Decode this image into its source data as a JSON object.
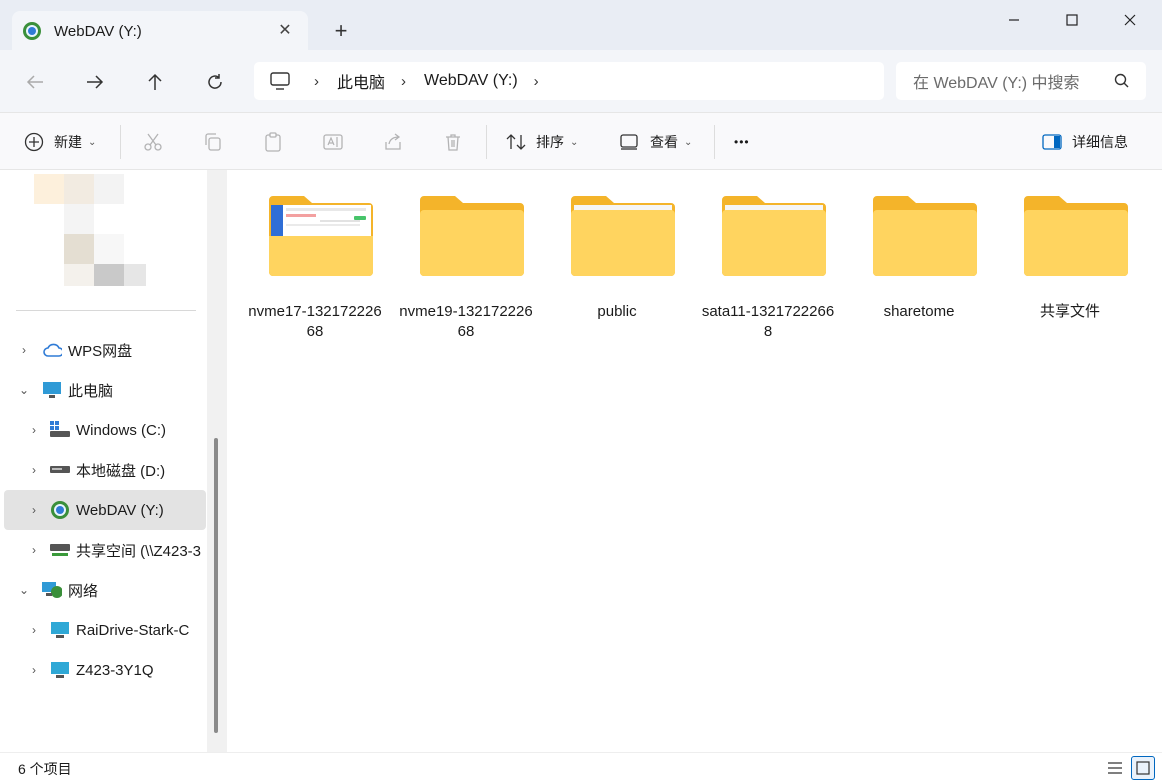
{
  "tab": {
    "title": "WebDAV (Y:)",
    "close": "✕",
    "new_tab": "+"
  },
  "window": {
    "minimize": "—",
    "maximize": "☐",
    "close": "✕"
  },
  "address": {
    "crumbs": [
      "此电脑",
      "WebDAV (Y:)"
    ],
    "search_placeholder": "在 WebDAV (Y:) 中搜索"
  },
  "toolbar": {
    "new_label": "新建",
    "sort_label": "排序",
    "view_label": "查看",
    "more_label": "•••",
    "details_label": "详细信息"
  },
  "sidebar": {
    "items": [
      {
        "label": "WPS网盘",
        "chevron": "›",
        "icon": "cloud-icon"
      },
      {
        "label": "此电脑",
        "chevron": "⌄",
        "icon": "monitor-icon"
      },
      {
        "label": "Windows (C:)",
        "chevron": "›",
        "icon": "windows-drive-icon"
      },
      {
        "label": "本地磁盘 (D:)",
        "chevron": "›",
        "icon": "drive-icon"
      },
      {
        "label": "WebDAV (Y:)",
        "chevron": "›",
        "icon": "webdav-icon",
        "selected": true
      },
      {
        "label": "共享空间 (\\\\Z423-3",
        "chevron": "›",
        "icon": "network-drive-icon"
      },
      {
        "label": "网络",
        "chevron": "⌄",
        "icon": "network-icon"
      },
      {
        "label": "RaiDrive-Stark-C",
        "chevron": "›",
        "icon": "computer-icon"
      },
      {
        "label": "Z423-3Y1Q",
        "chevron": "›",
        "icon": "computer-icon"
      }
    ]
  },
  "folders": [
    {
      "name": "nvme17-13217222668",
      "preview": true
    },
    {
      "name": "nvme19-13217222668"
    },
    {
      "name": "public",
      "paper": true
    },
    {
      "name": "sata11-13217222668",
      "paper": true
    },
    {
      "name": "sharetome"
    },
    {
      "name": "共享文件"
    }
  ],
  "status": {
    "count": "6 个项目"
  },
  "colors": {
    "folder_back": "#f4b42a",
    "folder_front": "#ffd45f",
    "accent": "#0067c0"
  }
}
